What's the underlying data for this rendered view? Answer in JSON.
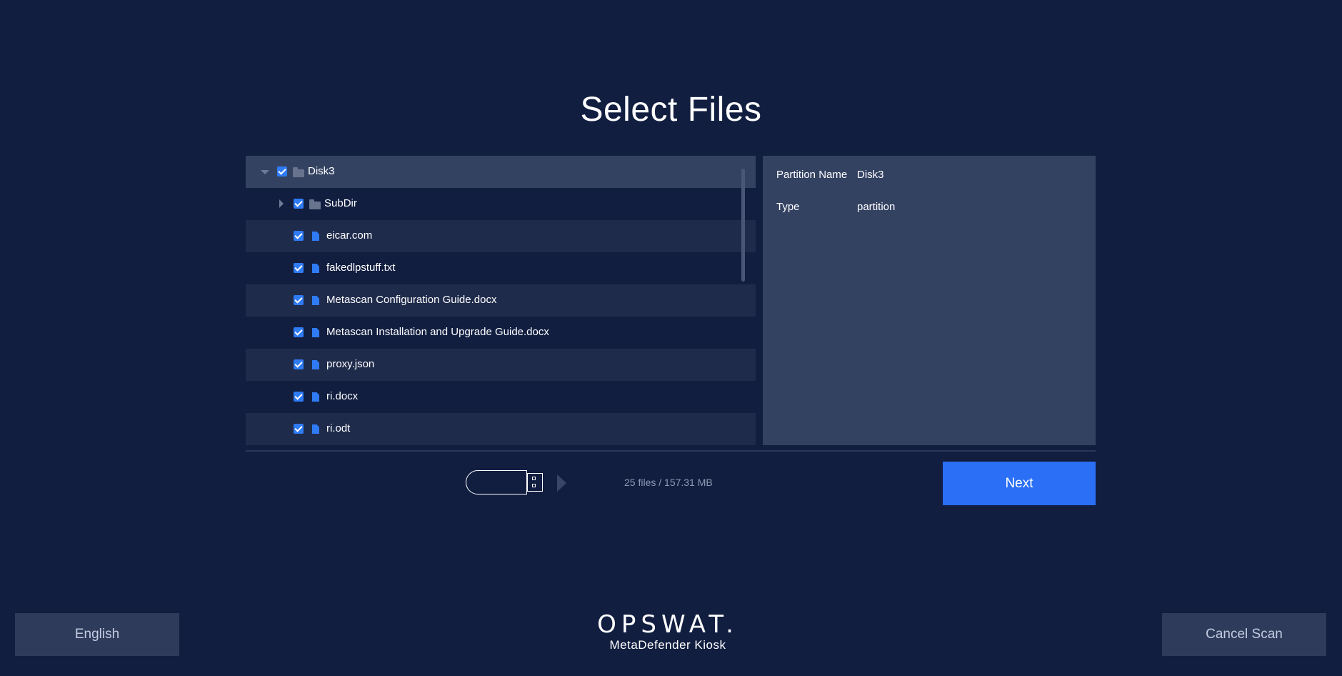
{
  "page": {
    "title": "Select Files"
  },
  "tree": {
    "items": [
      {
        "label": "Disk3",
        "kind": "folder",
        "checked": true,
        "expanded": true
      },
      {
        "label": "SubDir",
        "kind": "folder",
        "checked": true,
        "expanded": false
      },
      {
        "label": "eicar.com",
        "kind": "file",
        "checked": true
      },
      {
        "label": "fakedlpstuff.txt",
        "kind": "file",
        "checked": true
      },
      {
        "label": "Metascan Configuration Guide.docx",
        "kind": "file",
        "checked": true
      },
      {
        "label": "Metascan Installation and Upgrade Guide.docx",
        "kind": "file",
        "checked": true
      },
      {
        "label": "proxy.json",
        "kind": "file",
        "checked": true
      },
      {
        "label": "ri.docx",
        "kind": "file",
        "checked": true
      },
      {
        "label": "ri.odt",
        "kind": "file",
        "checked": true
      }
    ]
  },
  "details": {
    "partition_name_label": "Partition Name",
    "partition_name_value": "Disk3",
    "type_label": "Type",
    "type_value": "partition"
  },
  "summary": {
    "file_count": "25 files / 157.31 MB"
  },
  "actions": {
    "next_label": "Next",
    "language_label": "English",
    "cancel_label": "Cancel Scan"
  },
  "branding": {
    "logo_text": "OPSWAT.",
    "product_name": "MetaDefender Kiosk"
  },
  "icons": {
    "usb": "usb-drive-icon",
    "arrow": "arrow-right-icon",
    "folder": "folder-icon",
    "file": "file-icon",
    "checkbox": "checkbox-checked-icon"
  },
  "colors": {
    "background": "#111e40",
    "accent": "#2a6ff5",
    "panel": "#344262",
    "row_shade": "#1f2b4b"
  }
}
